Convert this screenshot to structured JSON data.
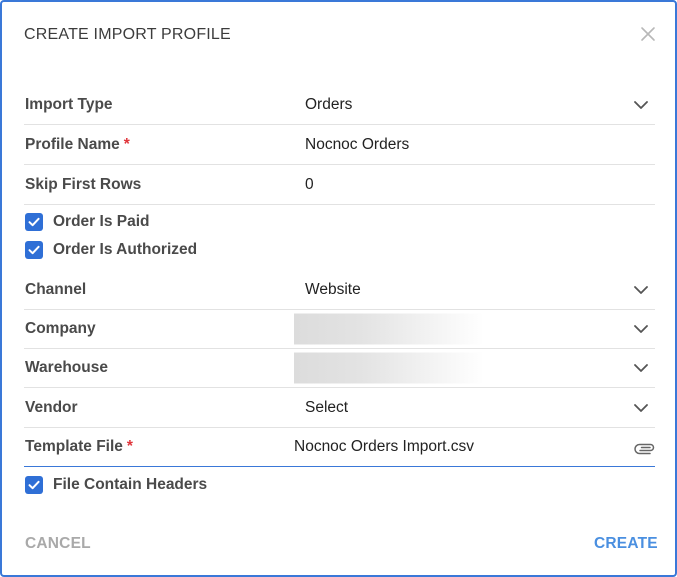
{
  "dialog": {
    "title": "CREATE IMPORT PROFILE"
  },
  "fields": {
    "import_type": {
      "label": "Import Type",
      "value": "Orders"
    },
    "profile_name": {
      "label": "Profile Name",
      "required_mark": "*",
      "value": "Nocnoc Orders"
    },
    "skip_first_rows": {
      "label": "Skip First Rows",
      "value": "0"
    },
    "channel": {
      "label": "Channel",
      "value": "Website"
    },
    "company": {
      "label": "Company"
    },
    "warehouse": {
      "label": "Warehouse"
    },
    "vendor": {
      "label": "Vendor",
      "value": "Select"
    },
    "template_file": {
      "label": "Template File",
      "required_mark": "*",
      "value": "Nocnoc Orders Import.csv"
    }
  },
  "checkboxes": {
    "order_is_paid": {
      "label": "Order Is Paid",
      "checked": true
    },
    "order_is_authorized": {
      "label": "Order Is Authorized",
      "checked": true
    },
    "file_contain_headers": {
      "label": "File Contain Headers",
      "checked": true
    }
  },
  "actions": {
    "cancel_label": "CANCEL",
    "create_label": "CREATE"
  },
  "colors": {
    "accent": "#2f6fd6",
    "required": "#e0353b",
    "cancel": "#a9a9a9",
    "create": "#4a8fe0"
  },
  "icons": {
    "close": "close-icon",
    "dropdown": "chevron-down-icon",
    "attach": "paperclip-icon",
    "check": "check-icon"
  }
}
